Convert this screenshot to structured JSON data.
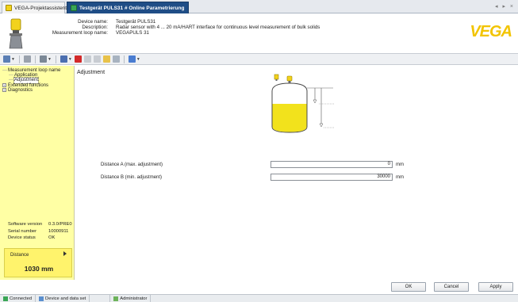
{
  "tabs": [
    {
      "label": "VEGA-Projektassistent",
      "icon": "wizard-icon"
    },
    {
      "label": "Testgerät PULS31 # Online Parametrierung",
      "icon": "device-online-icon"
    }
  ],
  "tab_nav": "◂ ▸ ×",
  "header": {
    "labels": [
      "Device name:",
      "Description:",
      "Measurement loop name:"
    ],
    "values": [
      "Testgerät PULS31",
      "Radar sensor with 4 ... 20 mA/HART interface for continuous level measurement of bulk solids",
      "VEGAPULS 31"
    ],
    "logo": "VEGA"
  },
  "toolbar": {
    "icons": [
      "view-icon",
      "print-icon",
      "tools-icon",
      "device-icon",
      "connect-icon",
      "stop-icon",
      "pause-icon",
      "folder-icon",
      "edit-icon",
      "help-icon"
    ]
  },
  "tree": [
    {
      "label": "Measurement loop name",
      "level": 0,
      "expander": ""
    },
    {
      "label": "Application",
      "level": 1,
      "expander": ""
    },
    {
      "label": "Adjustment",
      "level": 1,
      "expander": "",
      "selected": true
    },
    {
      "label": "Extended functions",
      "level": 0,
      "expander": "+"
    },
    {
      "label": "Diagnostics",
      "level": 0,
      "expander": "+"
    }
  ],
  "info": {
    "software_version_label": "Software version",
    "software_version_value": "0.3.0/PRE0",
    "serial_number_label": "Serial number",
    "serial_number_value": "10000911",
    "device_status_label": "Device status",
    "device_status_value": "OK"
  },
  "distance": {
    "title": "Distance",
    "value": "1030 mm"
  },
  "main": {
    "title": "Adjustment",
    "distance_a_label": "Distance A (max. adjustment)",
    "distance_a_value": "0",
    "distance_b_label": "Distance B (min. adjustment)",
    "distance_b_value": "30000",
    "unit": "mm"
  },
  "buttons": {
    "ok": "OK",
    "cancel": "Cancel",
    "apply": "Apply"
  },
  "status": [
    {
      "label": "Connected",
      "icon": "connected-icon"
    },
    {
      "label": "Device and data set",
      "icon": "device-data-icon"
    },
    {
      "label": "",
      "icon": ""
    },
    {
      "label": "Administrator",
      "icon": "user-icon"
    }
  ],
  "colors": {
    "panel_yellow": "#ffffa4",
    "distance_yellow": "#fff36c",
    "tab_active": "#1f4d86",
    "brand_yellow": "#f2c400"
  }
}
